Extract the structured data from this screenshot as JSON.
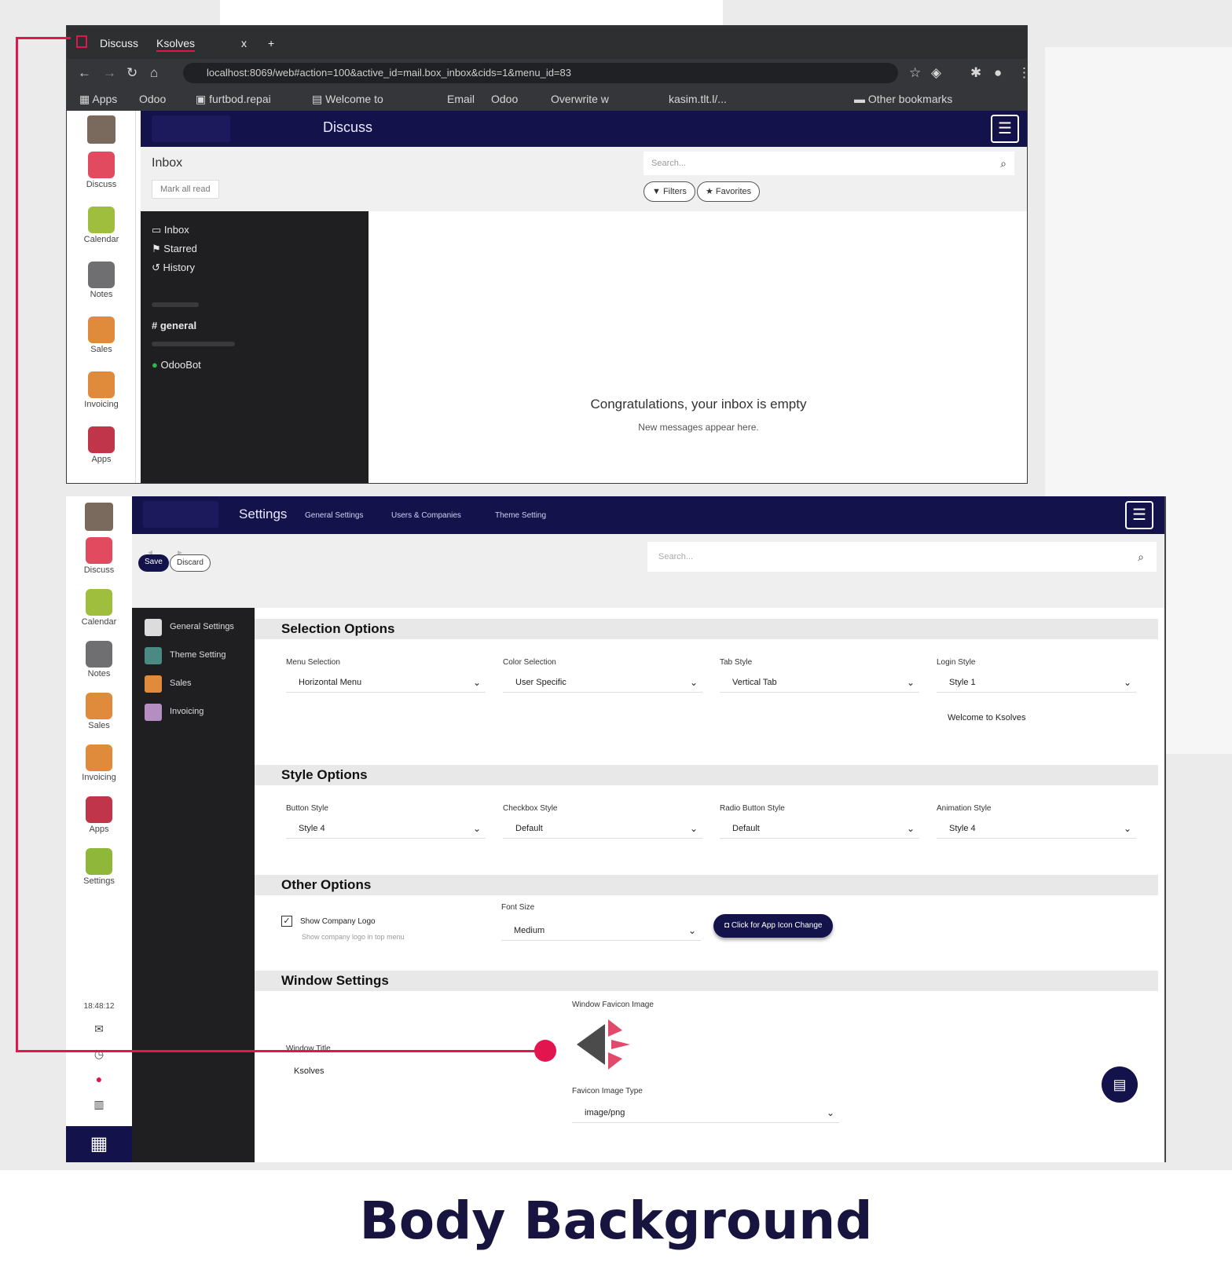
{
  "browser": {
    "tabs": [
      "Discuss",
      "Ksolves"
    ],
    "tab_close": "x",
    "new_tab": "+",
    "address": "localhost:8069/web#action=100&active_id=mail.box_inbox&cids=1&menu_id=83",
    "bookmarks": [
      "Apps",
      "Odoo",
      "furtbod.repai",
      "Welcome to",
      "Email",
      "Odoo",
      "Overwrite w",
      "kasim.tlt.l/..."
    ],
    "other_bookmarks": "Other bookmarks"
  },
  "discuss_app": {
    "rail": [
      {
        "label": "Discuss",
        "icon": "discuss-icon",
        "color": "#e24a5f"
      },
      {
        "label": "Calendar",
        "icon": "calendar-icon",
        "color": "#9fbe3d"
      },
      {
        "label": "Notes",
        "icon": "notes-icon",
        "color": "#6f6f72"
      },
      {
        "label": "Sales",
        "icon": "sales-icon",
        "color": "#e08a3c"
      },
      {
        "label": "Invoicing",
        "icon": "invoicing-icon",
        "color": "#e08a3c"
      },
      {
        "label": "Apps",
        "icon": "apps-icon",
        "color": "#c0354a"
      }
    ],
    "header_title": "Discuss",
    "breadcrumb": "Inbox",
    "mark_all_read": "Mark all read",
    "search_placeholder": "Search...",
    "filters": "Filters",
    "favorites": "Favorites",
    "sidebar": {
      "mailboxes": [
        "Inbox",
        "Starred",
        "History"
      ],
      "channel": "general",
      "direct_message": "OdooBot"
    },
    "empty_title": "Congratulations, your inbox is empty",
    "empty_sub": "New messages appear here."
  },
  "settings_app": {
    "rail": [
      {
        "label": "Discuss",
        "icon": "discuss-icon",
        "color": "#e24a5f"
      },
      {
        "label": "Calendar",
        "icon": "calendar-icon",
        "color": "#9fbe3d"
      },
      {
        "label": "Notes",
        "icon": "notes-icon",
        "color": "#6f6f72"
      },
      {
        "label": "Sales",
        "icon": "sales-icon",
        "color": "#e08a3c"
      },
      {
        "label": "Invoicing",
        "icon": "invoicing-icon",
        "color": "#e08a3c"
      },
      {
        "label": "Apps",
        "icon": "apps-icon",
        "color": "#c0354a"
      },
      {
        "label": "Settings",
        "icon": "settings-icon",
        "color": "#8fb83b"
      }
    ],
    "clock": "18:48:12",
    "header_title": "Settings",
    "header_links": [
      "General Settings",
      "Users & Companies",
      "Theme Setting"
    ],
    "search_placeholder": "Search...",
    "view_buttons": [
      "Save",
      "Discard"
    ],
    "side_items": [
      "General Settings",
      "Theme Setting",
      "Sales",
      "Invoicing"
    ],
    "sections": {
      "selection": {
        "title": "Selection Options",
        "fields": [
          {
            "label": "Menu Selection",
            "value": "Horizontal Menu"
          },
          {
            "label": "Color Selection",
            "value": "User Specific"
          },
          {
            "label": "Tab Style",
            "value": "Vertical Tab"
          },
          {
            "label": "Login Style",
            "value": "Style 1"
          }
        ],
        "login_note": "Welcome to Ksolves"
      },
      "style": {
        "title": "Style Options",
        "fields": [
          {
            "label": "Button Style",
            "value": "Style 4"
          },
          {
            "label": "Checkbox Style",
            "value": "Default"
          },
          {
            "label": "Radio Button Style",
            "value": "Default"
          },
          {
            "label": "Animation Style",
            "value": "Style 4"
          }
        ]
      },
      "other": {
        "title": "Other Options",
        "show_company_logo": "Show Company Logo",
        "company_logo_hint": "Show company logo in top menu",
        "font_size_label": "Font Size",
        "font_size_value": "Medium",
        "icon_change_button": "Click for App Icon Change"
      },
      "window": {
        "title": "Window Settings",
        "favicon_label": "Window Favicon Image",
        "title_label": "Window Title",
        "title_value": "Ksolves",
        "favicon_type_label": "Favicon Image Type",
        "favicon_type_value": "image/png"
      }
    }
  },
  "annotation_color": "#e3154e",
  "caption": "Body Background"
}
